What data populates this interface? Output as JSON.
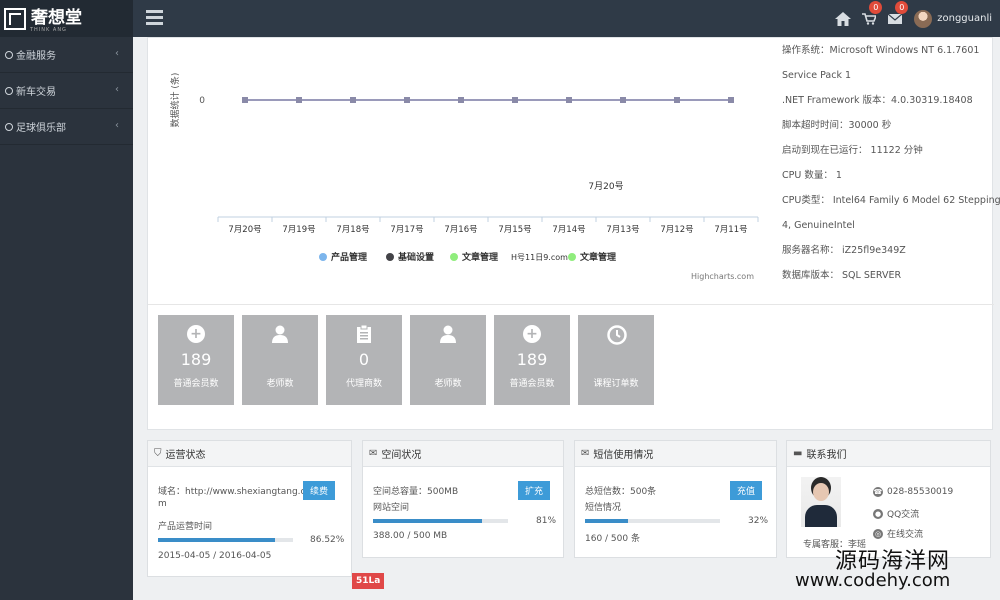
{
  "brand": {
    "name": "奢想堂",
    "subtitle": "THINK ANG"
  },
  "header": {
    "cart_badge": "0",
    "mail_badge": "0",
    "username": "zongguanli"
  },
  "sidebar": {
    "items": [
      {
        "label": "金融服务",
        "icon": "finance-icon"
      },
      {
        "label": "新车交易",
        "icon": "car-icon"
      },
      {
        "label": "足球俱乐部",
        "icon": "user-icon"
      }
    ]
  },
  "chart_data": {
    "type": "line",
    "ylabel": "数据统计 (条)",
    "categories": [
      "7月20号",
      "7月19号",
      "7月18号",
      "7月17号",
      "7月16号",
      "7月15号",
      "7月14号",
      "7月13号",
      "7月12号",
      "7月11号"
    ],
    "series": [
      {
        "name": "产品管理",
        "values": [
          0,
          0,
          0,
          0,
          0,
          0,
          0,
          0,
          0,
          0
        ]
      },
      {
        "name": "基础设置",
        "values": [
          0,
          0,
          0,
          0,
          0,
          0,
          0,
          0,
          0,
          0
        ]
      },
      {
        "name": "文章管理",
        "values": [
          0,
          0,
          0,
          0,
          0,
          0,
          0,
          0,
          0,
          0
        ]
      },
      {
        "name": "文章管理",
        "values": [
          0,
          0,
          0,
          0,
          0,
          0,
          0,
          0,
          0,
          0
        ]
      }
    ],
    "y_ticks": [
      "0"
    ],
    "tooltip_label": "7月20号",
    "credit": "Highcharts.com",
    "series_colors": [
      "#7cb5ec",
      "#434348",
      "#90ed7d",
      "#90ed7d"
    ],
    "legend_position": "bottom"
  },
  "sysinfo": [
    "操作系统：Microsoft Windows NT 6.1.7601",
    "Service Pack 1",
    ".NET Framework 版本：4.0.30319.18408",
    "脚本超时时间：30000 秒",
    "启动到现在已运行： 11122 分钟",
    "CPU 数量： 1",
    "CPU类型： Intel64 Family 6 Model 62 Stepping",
    "4, GenuineIntel",
    "服务器名称： iZ25fl9e349Z",
    "数据库版本： SQL SERVER"
  ],
  "tiles": [
    {
      "number": "189",
      "label": "普通会员数",
      "icon": "plus-icon"
    },
    {
      "number": "",
      "label": "老师数",
      "icon": "person-icon"
    },
    {
      "number": "0",
      "label": "代理商数",
      "icon": "clipboard-icon"
    },
    {
      "number": "",
      "label": "老师数",
      "icon": "person-icon"
    },
    {
      "number": "189",
      "label": "普通会员数",
      "icon": "plus-icon"
    },
    {
      "number": "",
      "label": "课程订单数",
      "icon": "clock-icon"
    }
  ],
  "ops": {
    "title": "运营状态",
    "domain_line1": "域名：http://www.shexiangtang.co",
    "domain_line2": "m",
    "renew_label": "续费",
    "period_label": "产品运营时间",
    "percent_text": "86.52%",
    "percent": 86.52,
    "dates": "2015-04-05 / 2016-04-05"
  },
  "space": {
    "title": "空间状况",
    "total_label": "空间总容量：500MB",
    "expand_label": "扩充",
    "usage_label": "网站空间",
    "percent_text": "81%",
    "percent": 81,
    "usage_text": "388.00 / 500 MB"
  },
  "sms": {
    "title": "短信使用情况",
    "total_label": "总短信数：500条",
    "recharge_label": "充值",
    "usage_label": "短信情况",
    "percent_text": "32%",
    "percent": 32,
    "usage_text": "160 / 500 条"
  },
  "contact": {
    "title": "联系我们",
    "phone": "028-85530019",
    "qq": "QQ交流",
    "online": "在线交流",
    "agent": "专属客服：李瑶"
  },
  "corner_tag": "51La",
  "watermark": {
    "cn": "源码海洋网",
    "url": "www.codehy.com"
  },
  "stray_text": "H号11日9.com"
}
